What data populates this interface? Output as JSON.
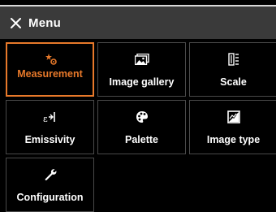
{
  "header": {
    "title": "Menu",
    "close_icon": "close-icon"
  },
  "colors": {
    "accent": "#e8792a",
    "header_bg": "#3a3a3a",
    "tile_border": "#4a4a4a"
  },
  "menu": {
    "items": [
      {
        "label": "Measurement",
        "icon": "measurement-icon",
        "active": true
      },
      {
        "label": "Image gallery",
        "icon": "image-gallery-icon",
        "active": false
      },
      {
        "label": "Scale",
        "icon": "scale-icon",
        "active": false
      },
      {
        "label": "Emissivity",
        "icon": "emissivity-icon",
        "active": false
      },
      {
        "label": "Palette",
        "icon": "palette-icon",
        "active": false
      },
      {
        "label": "Image type",
        "icon": "image-type-icon",
        "active": false
      },
      {
        "label": "Configuration",
        "icon": "configuration-icon",
        "active": false
      }
    ]
  }
}
